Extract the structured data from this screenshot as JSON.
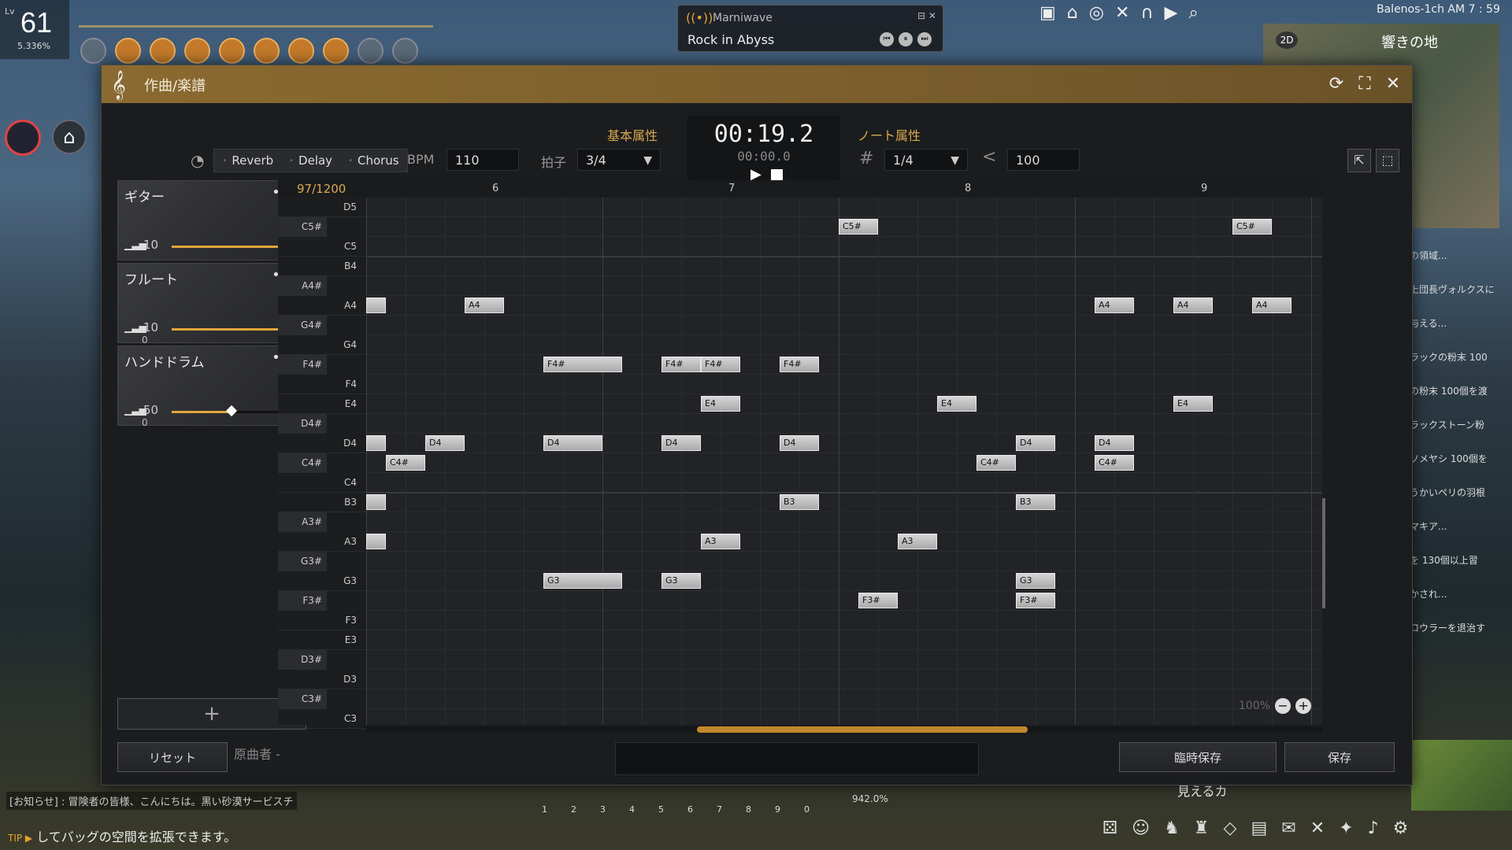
{
  "hud": {
    "level_label": "Lv",
    "level": "61",
    "exp_pct": "5.336%",
    "server": "Balenos-1ch",
    "clock": "AM 7 : 59",
    "minimap_mode": "2D",
    "minimap_title": "響きの地",
    "tip_prefix": "TIP ▶",
    "tip": "してバッグの空間を拡張できます。",
    "notice": "[お知らせ] : 冒険者の皆様、こんにちは。黒い砂漠サービスチ",
    "tip_right": "見えるカ",
    "hotbar_pct": "942.0%",
    "hotbar_nums": [
      "1",
      "2",
      "3",
      "4",
      "5",
      "6",
      "7",
      "8",
      "9",
      "0"
    ],
    "quest_lines": [
      "の領域...",
      "上団長ヴォルクスに",
      "与える...",
      "ラックの粉末 100",
      "の粉末 100個を渡",
      "ラックストーン粉",
      "ソメヤシ 100個を",
      "うかいペリの羽根",
      "マキア...",
      "を 130個以上習",
      "かされ...",
      "ロウラーを退治す"
    ]
  },
  "radio": {
    "name": "Marniwave",
    "song": "Rock in Abyss"
  },
  "window": {
    "title": "作曲/楽譜",
    "effects": [
      "Reverb",
      "Delay",
      "Chorus"
    ],
    "basic_attr_label": "基本属性",
    "note_attr_label": "ノート属性",
    "bpm_label": "BPM",
    "bpm": "110",
    "beat_label": "拍子",
    "beat": "3/4",
    "note_len": "1/4",
    "velocity": "100",
    "time_current": "00:19.2",
    "time_total": "00:00.0",
    "measure_counter": "97/1200",
    "measure_numbers": [
      "6",
      "7",
      "8",
      "9"
    ],
    "zoom": "100%",
    "reset_label": "リセット",
    "original_author_label": "原曲者 -",
    "temp_save_label": "臨時保存",
    "save_label": "保存"
  },
  "instruments": [
    {
      "name": "ギター",
      "volume": "10",
      "level": 1.0,
      "sub": ""
    },
    {
      "name": "フルート",
      "volume": "10",
      "level": 1.0,
      "sub": "0"
    },
    {
      "name": "ハンドドラム",
      "volume": "50",
      "level": 0.5,
      "sub": "0"
    }
  ],
  "keys": [
    "D5",
    "C5#",
    "C5",
    "B4",
    "A4#",
    "A4",
    "G4#",
    "G4",
    "F4#",
    "F4",
    "E4",
    "D4#",
    "D4",
    "C4#",
    "C4",
    "B3",
    "A3#",
    "A3",
    "G3#",
    "G3",
    "F3#",
    "F3",
    "E3",
    "D3#",
    "D3",
    "C3#",
    "C3"
  ],
  "notes": [
    {
      "label": "C5#",
      "key": "C5#",
      "beat": 12,
      "len": 1
    },
    {
      "label": "C5#",
      "key": "C5#",
      "beat": 22,
      "len": 1
    },
    {
      "label": "",
      "key": "A4",
      "beat": 0,
      "len": 0.5
    },
    {
      "label": "A4",
      "key": "A4",
      "beat": 2.5,
      "len": 1
    },
    {
      "label": "A4",
      "key": "A4",
      "beat": 18.5,
      "len": 1
    },
    {
      "label": "A4",
      "key": "A4",
      "beat": 20.5,
      "len": 1
    },
    {
      "label": "A4",
      "key": "A4",
      "beat": 22.5,
      "len": 1
    },
    {
      "label": "F4#",
      "key": "F4#",
      "beat": 4.5,
      "len": 2
    },
    {
      "label": "F4#",
      "key": "F4#",
      "beat": 7.5,
      "len": 1
    },
    {
      "label": "F4#",
      "key": "F4#",
      "beat": 8.5,
      "len": 1
    },
    {
      "label": "F4#",
      "key": "F4#",
      "beat": 10.5,
      "len": 1
    },
    {
      "label": "E4",
      "key": "E4",
      "beat": 8.5,
      "len": 1
    },
    {
      "label": "E4",
      "key": "E4",
      "beat": 14.5,
      "len": 1
    },
    {
      "label": "E4",
      "key": "E4",
      "beat": 20.5,
      "len": 1
    },
    {
      "label": "",
      "key": "D4",
      "beat": 0,
      "len": 0.5
    },
    {
      "label": "D4",
      "key": "D4",
      "beat": 1.5,
      "len": 1
    },
    {
      "label": "D4",
      "key": "D4",
      "beat": 4.5,
      "len": 1.5
    },
    {
      "label": "D4",
      "key": "D4",
      "beat": 7.5,
      "len": 1
    },
    {
      "label": "D4",
      "key": "D4",
      "beat": 10.5,
      "len": 1
    },
    {
      "label": "D4",
      "key": "D4",
      "beat": 16.5,
      "len": 1
    },
    {
      "label": "D4",
      "key": "D4",
      "beat": 18.5,
      "len": 1
    },
    {
      "label": "C4#",
      "key": "C4#",
      "beat": 0.5,
      "len": 1
    },
    {
      "label": "C4#",
      "key": "C4#",
      "beat": 15.5,
      "len": 1
    },
    {
      "label": "C4#",
      "key": "C4#",
      "beat": 18.5,
      "len": 1
    },
    {
      "label": "",
      "key": "B3",
      "beat": 0,
      "len": 0.5
    },
    {
      "label": "B3",
      "key": "B3",
      "beat": 10.5,
      "len": 1
    },
    {
      "label": "B3",
      "key": "B3",
      "beat": 16.5,
      "len": 1
    },
    {
      "label": "",
      "key": "A3",
      "beat": 0,
      "len": 0.5
    },
    {
      "label": "A3",
      "key": "A3",
      "beat": 8.5,
      "len": 1
    },
    {
      "label": "A3",
      "key": "A3",
      "beat": 13.5,
      "len": 1
    },
    {
      "label": "G3",
      "key": "G3",
      "beat": 4.5,
      "len": 2
    },
    {
      "label": "G3",
      "key": "G3",
      "beat": 7.5,
      "len": 1
    },
    {
      "label": "G3",
      "key": "G3",
      "beat": 16.5,
      "len": 1
    },
    {
      "label": "F3#",
      "key": "F3#",
      "beat": 12.5,
      "len": 1
    },
    {
      "label": "F3#",
      "key": "F3#",
      "beat": 16.5,
      "len": 1
    }
  ]
}
